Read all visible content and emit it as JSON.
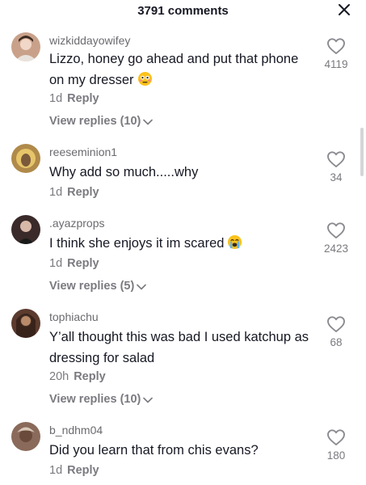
{
  "header": {
    "title": "3791 comments"
  },
  "comments": [
    {
      "username": "wizkiddayowifey",
      "text": "Lizzo, honey go ahead and put that phone on my dresser",
      "emoji": "flushed-face",
      "age": "1d",
      "reply_label": "Reply",
      "view_replies": "View replies (10)",
      "likes": "4119",
      "avatar_color": "#c9a18a"
    },
    {
      "username": "reeseminion1",
      "text": "Why add so much.....why",
      "age": "1d",
      "reply_label": "Reply",
      "likes": "34",
      "avatar_color": "#b08a4a"
    },
    {
      "username": ".ayazprops",
      "text": "I think she enjoys it im scared",
      "emoji": "loudly-crying-face",
      "age": "1d",
      "reply_label": "Reply",
      "view_replies": "View replies (5)",
      "likes": "2423",
      "avatar_color": "#3a2a2a"
    },
    {
      "username": "tophiachu",
      "text": "Y’all thought this was bad I used katchup as dressing for salad",
      "age": "20h",
      "reply_label": "Reply",
      "view_replies": "View replies (10)",
      "likes": "68",
      "avatar_color": "#5b3b2e"
    },
    {
      "username": "b_ndhm04",
      "text": "Did you learn that from chis evans?",
      "age": "1d",
      "reply_label": "Reply",
      "likes": "180",
      "avatar_color": "#8a6a5a"
    }
  ]
}
